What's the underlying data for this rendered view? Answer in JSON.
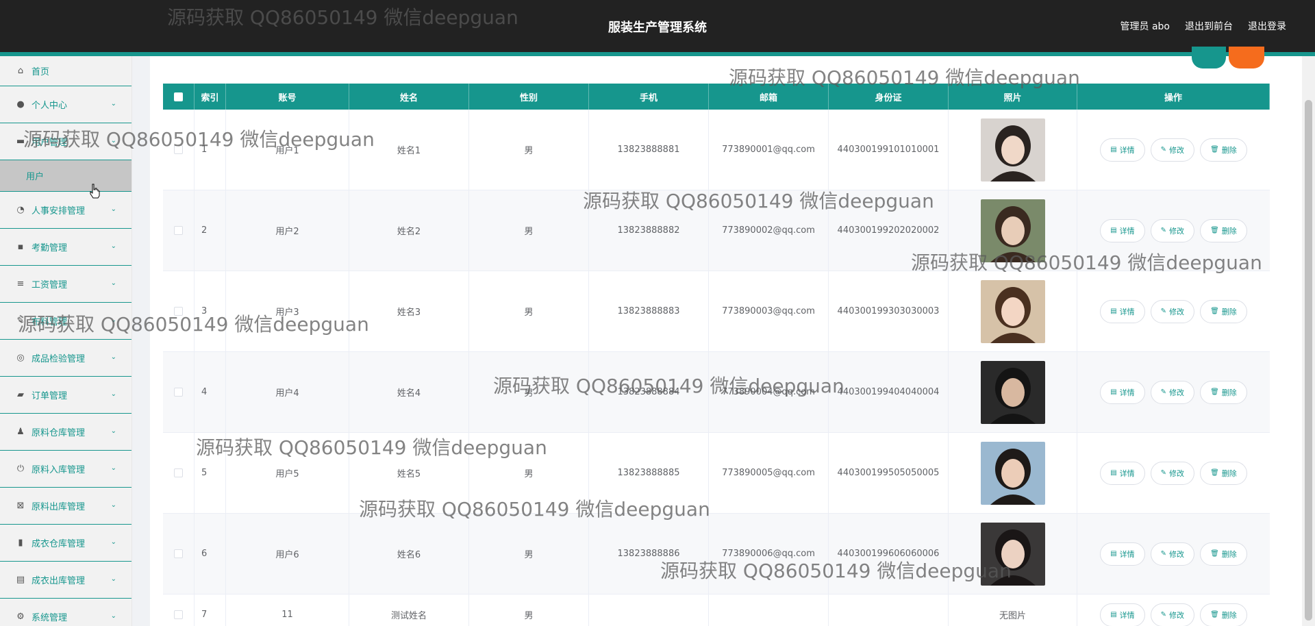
{
  "header": {
    "title": "服装生产管理系统",
    "admin_label": "管理员 abo",
    "front_label": "退出到前台",
    "logout_label": "退出登录"
  },
  "sidebar": {
    "items": [
      {
        "label": "首页",
        "icon": "home-icon"
      },
      {
        "label": "个人中心",
        "icon": "user-icon"
      },
      {
        "label": "用户管理",
        "icon": "card-icon"
      },
      {
        "label": "用户",
        "icon": ""
      },
      {
        "label": "人事安排管理",
        "icon": "dial-icon"
      },
      {
        "label": "考勤管理",
        "icon": "chat-icon"
      },
      {
        "label": "工资管理",
        "icon": "list-icon"
      },
      {
        "label": "布料管理",
        "icon": "pin-icon"
      },
      {
        "label": "成品检验管理",
        "icon": "target-icon"
      },
      {
        "label": "订单管理",
        "icon": "stamp-icon"
      },
      {
        "label": "原料仓库管理",
        "icon": "person-icon"
      },
      {
        "label": "原料入库管理",
        "icon": "power-icon"
      },
      {
        "label": "原料出库管理",
        "icon": "box-icon"
      },
      {
        "label": "成衣仓库管理",
        "icon": "chart-icon"
      },
      {
        "label": "成衣出库管理",
        "icon": "clipboard-icon"
      },
      {
        "label": "系统管理",
        "icon": "settings-icon"
      }
    ]
  },
  "table": {
    "headers": [
      "",
      "索引",
      "账号",
      "姓名",
      "性别",
      "手机",
      "邮箱",
      "身份证",
      "照片",
      "操作"
    ],
    "rows": [
      {
        "index": "1",
        "account": "用户1",
        "name": "姓名1",
        "gender": "男",
        "phone": "13823888881",
        "email": "773890001@qq.com",
        "id_card": "440300199101010001",
        "photo": "photo-1"
      },
      {
        "index": "2",
        "account": "用户2",
        "name": "姓名2",
        "gender": "男",
        "phone": "13823888882",
        "email": "773890002@qq.com",
        "id_card": "440300199202020002",
        "photo": "photo-2"
      },
      {
        "index": "3",
        "account": "用户3",
        "name": "姓名3",
        "gender": "男",
        "phone": "13823888883",
        "email": "773890003@qq.com",
        "id_card": "440300199303030003",
        "photo": "photo-3"
      },
      {
        "index": "4",
        "account": "用户4",
        "name": "姓名4",
        "gender": "男",
        "phone": "13823888884",
        "email": "773890004@qq.com",
        "id_card": "440300199404040004",
        "photo": "photo-4"
      },
      {
        "index": "5",
        "account": "用户5",
        "name": "姓名5",
        "gender": "男",
        "phone": "13823888885",
        "email": "773890005@qq.com",
        "id_card": "440300199505050005",
        "photo": "photo-5"
      },
      {
        "index": "6",
        "account": "用户6",
        "name": "姓名6",
        "gender": "男",
        "phone": "13823888886",
        "email": "773890006@qq.com",
        "id_card": "440300199606060006",
        "photo": "photo-6"
      },
      {
        "index": "7",
        "account": "11",
        "name": "测试姓名",
        "gender": "男",
        "phone": "",
        "email": "",
        "id_card": "",
        "photo": "",
        "no_photo": "无图片"
      }
    ],
    "actions": {
      "detail": "详情",
      "edit": "修改",
      "delete": "删除"
    }
  },
  "watermark": "源码获取 QQ86050149 微信deepguan",
  "colors": {
    "accent": "#16968d",
    "header": "#222222",
    "danger": "#f56c1d"
  }
}
